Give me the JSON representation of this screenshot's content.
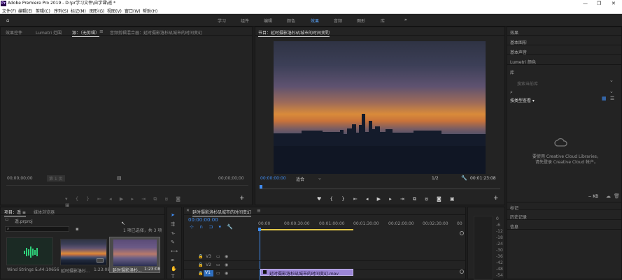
{
  "app": {
    "title": "Adobe Premiere Pro 2019 - D:\\pr学习文件\\自学课\\遥 *",
    "icon": "Pr"
  },
  "window_controls": {
    "minimize": "—",
    "maximize": "❐",
    "close": "✕"
  },
  "menu": [
    "文件(F)",
    "编辑(E)",
    "剪辑(C)",
    "序列(S)",
    "标记(M)",
    "图形(G)",
    "视图(V)",
    "窗口(W)",
    "帮助(H)"
  ],
  "workspaces": {
    "items": [
      "学习",
      "组件",
      "编辑",
      "颜色",
      "效果",
      "音频",
      "图形",
      "库"
    ],
    "active": "效果",
    "more": "»"
  },
  "source_panel": {
    "tabs": [
      "效果控件",
      "Lumetri 范围",
      "源：（无剪辑）",
      "音频剪辑混合器：延时摄影洛杉矶城市的时间变幻"
    ],
    "active_tab": "源：（无剪辑）",
    "timecode_left": "00;00;00;00",
    "page": "第 1 页",
    "timecode_right": "00;00;00;00"
  },
  "program_panel": {
    "title": "节目：延时摄影洛杉矶城市的时间变幻",
    "timecode": "00:00:00:00",
    "fit": "适合",
    "resolution": "1/2",
    "duration": "00:01:23:08"
  },
  "right_panel": {
    "items": [
      "效果",
      "基本图形",
      "基本声音",
      "Lumetri 颜色",
      "库"
    ],
    "search_placeholder": "搜索当前库",
    "library_view": "按类型查看 ▾",
    "cc_message_1": "要使用 Creative Cloud Libraries，",
    "cc_message_2": "请先登录 Creative Cloud 帐户。",
    "size": "-- KB",
    "bottom_items": [
      "标记",
      "历史记录",
      "信息"
    ]
  },
  "project_panel": {
    "tabs": [
      "项目：遥 ≡",
      "媒体浏览器"
    ],
    "project_file": "遥.prproj",
    "selection": "1 项已选择，共 3 项",
    "items": [
      {
        "name": "Wind Strings -...",
        "duration": "5:44:10656"
      },
      {
        "name": "延时摄影洛杉...",
        "duration": "1:23:08"
      },
      {
        "name": "延时摄影洛杉...",
        "duration": "1:23:08"
      }
    ]
  },
  "timeline": {
    "title": "延时摄影洛杉矶城市的时间变幻",
    "timecode": "00:00:00:00",
    "ruler": [
      "00:00",
      "00:00:30:00",
      "00:01:00:00",
      "00:01:30:00",
      "00:02:00:00",
      "00:02:30:00",
      "00"
    ],
    "tracks": [
      "V3",
      "V2",
      "V1"
    ],
    "clip_label": "延时摄影洛杉矶城市的时间变幻.mov"
  },
  "meter_labels": [
    "0",
    "-6",
    "-12",
    "-18",
    "-24",
    "-30",
    "-36",
    "-42",
    "-48",
    "-54"
  ],
  "colors": {
    "accent": "#3f8cf2",
    "clip": "#9c86d6",
    "work_area": "#e3c84a"
  }
}
